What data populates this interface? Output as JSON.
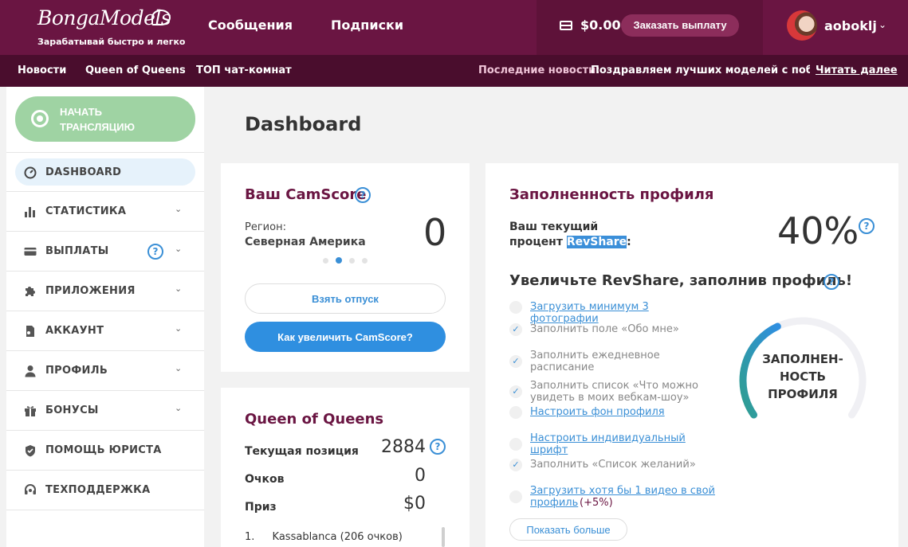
{
  "header": {
    "logo_text": "BongaModels",
    "logo_tagline": "Зарабатывай быстро и легко",
    "nav": [
      "Сообщения",
      "Подписки"
    ],
    "balance": "$0.00",
    "payout_button": "Заказать выплату",
    "username": "aoboklj",
    "chevron": "⌄"
  },
  "subnav": {
    "items": [
      "Новости",
      "Queen of Queens",
      "ТОП чат-комнат"
    ],
    "news_label": "Последние новости:",
    "news_text": "Поздравляем лучших моделей с победой",
    "news_link": "Читать далее"
  },
  "sidebar": {
    "broadcast_button": "НАЧАТЬ ТРАНСЛЯЦИЮ",
    "items": [
      {
        "label": "DASHBOARD",
        "icon": "speedometer-icon"
      },
      {
        "label": "СТАТИСТИКА",
        "icon": "bar-chart-icon"
      },
      {
        "label": "ВЫПЛАТЫ",
        "icon": "credit-card-icon"
      },
      {
        "label": "ПРИЛОЖЕНИЯ",
        "icon": "puzzle-icon"
      },
      {
        "label": "АККАУНТ",
        "icon": "document-icon"
      },
      {
        "label": "ПРОФИЛЬ",
        "icon": "user-icon"
      },
      {
        "label": "БОНУСЫ",
        "icon": "gift-icon"
      },
      {
        "label": "ПОМОЩЬ ЮРИСТА",
        "icon": "shield-icon"
      },
      {
        "label": "ТЕХПОДДЕРЖКА",
        "icon": "headset-icon"
      }
    ],
    "help_glyph": "?"
  },
  "main": {
    "title": "Dashboard",
    "camscore": {
      "title": "Ваш CamScore",
      "region_label": "Регион:",
      "region_value": "Северная Америка",
      "score": "0",
      "vacation_button": "Взять отпуск",
      "improve_button": "Как увеличить CamScore?"
    },
    "queen": {
      "title": "Queen of Queens",
      "rows": [
        {
          "label": "Текущая позиция",
          "value": "2884"
        },
        {
          "label": "Очков",
          "value": "0"
        },
        {
          "label": "Приз",
          "value": "$0"
        }
      ],
      "leaderboard": [
        {
          "rank": "1.",
          "name": "Kassablanca",
          "points": "(206 очков)"
        }
      ]
    },
    "profile": {
      "title": "Заполненность профиля",
      "revshare_label_before": "Ваш текущий процент ",
      "revshare_highlight": "RevShare",
      "revshare_label_after": ":",
      "revshare_value": "40%",
      "increase_title": "Увеличьте RevShare, заполнив профиль!",
      "progress": 0.4,
      "gauge_label": "ЗАПОЛНЕН-НОСТЬ ПРОФИЛЯ",
      "tasks": [
        {
          "text": "Загрузить минимум 3 фотографии",
          "done": false
        },
        {
          "text": "Заполнить поле «Обо мне»",
          "done": true
        },
        {
          "text": "Заполнить ежедневное расписание",
          "done": true
        },
        {
          "text": "Заполнить список «Что можно увидеть в моих вебкам-шоу»",
          "done": true
        },
        {
          "text": "Настроить фон профиля",
          "done": false
        },
        {
          "text": "Настроить индивидуальный шрифт",
          "done": false
        },
        {
          "text": "Заполнить «Список желаний»",
          "done": true
        },
        {
          "text": "Загрузить хотя бы 1 видео в свой профиль",
          "done": false,
          "bonus": "(+5%)"
        }
      ],
      "check_glyph": "✓",
      "more_button": "Показать больше"
    }
  },
  "colors": {
    "brand": "#6a1542",
    "accent": "#2f8fe0",
    "broadcast": "#9fd3a3",
    "gauge": "#2f9e8f"
  }
}
